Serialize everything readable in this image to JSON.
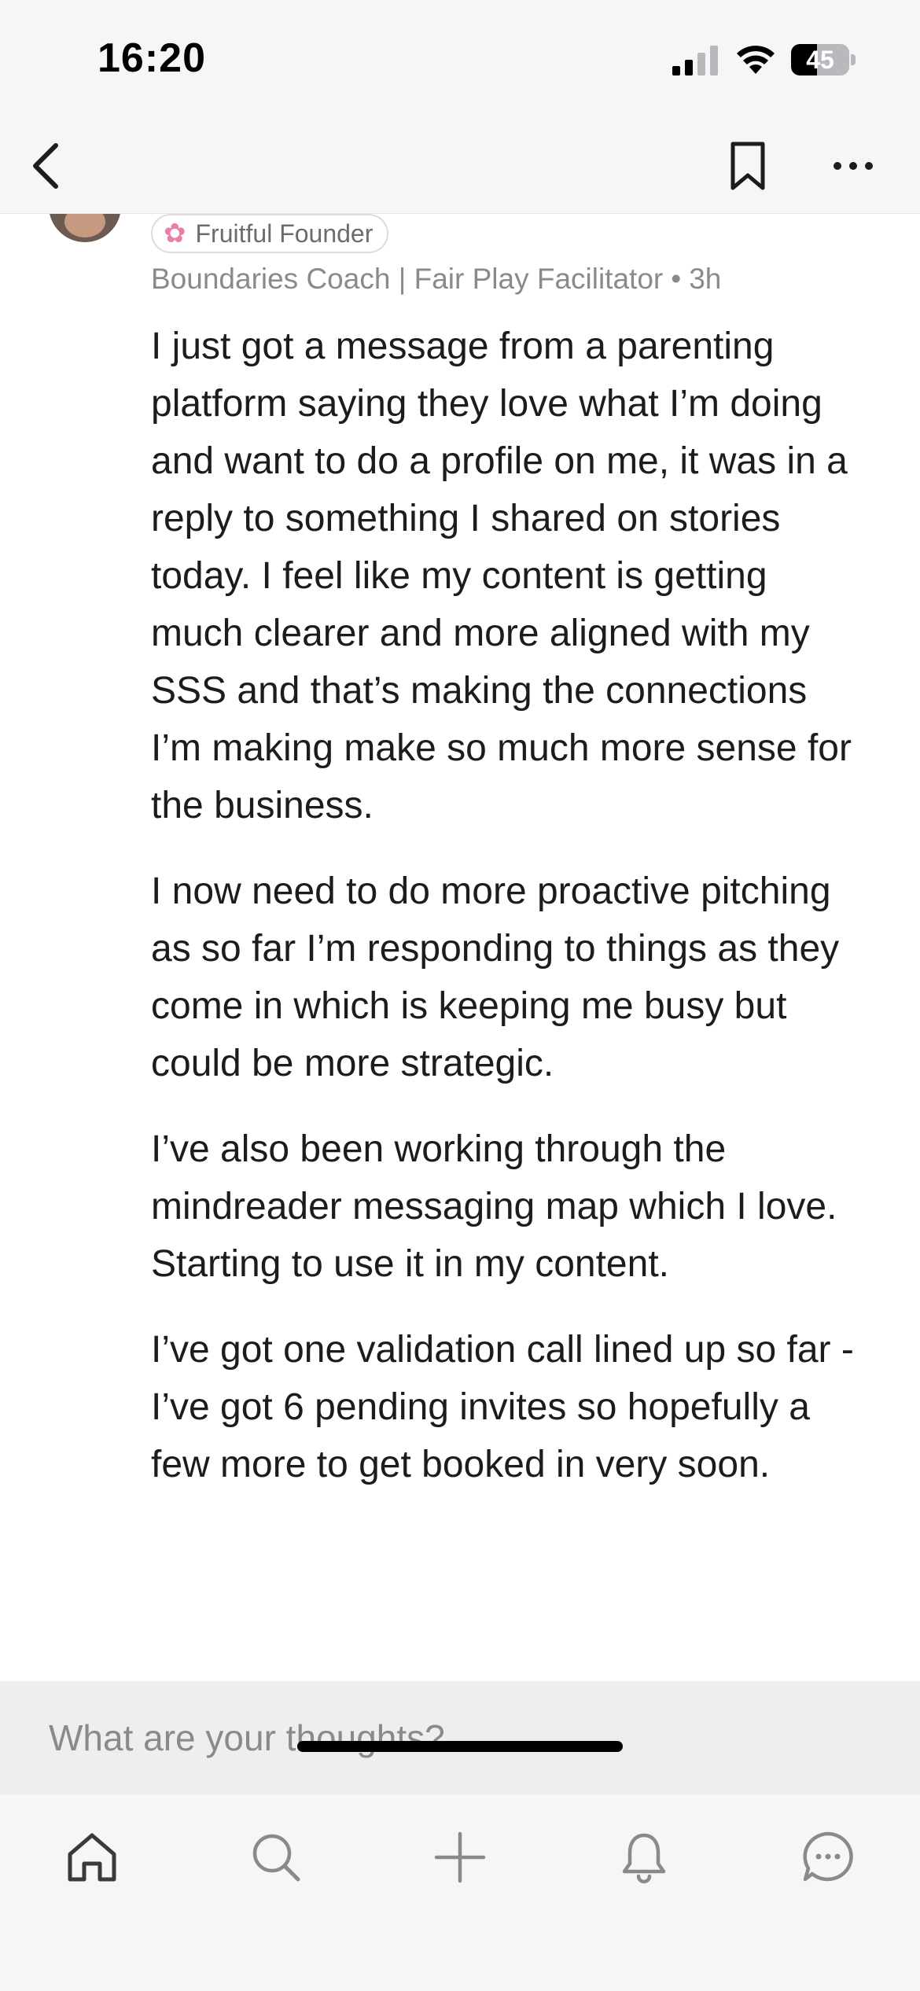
{
  "status_bar": {
    "time": "16:20",
    "battery_level": "45",
    "battery_fraction": 0.45
  },
  "nav": {
    "icons": [
      "chevron-left-icon",
      "bookmark-icon",
      "more-horizontal-icon"
    ]
  },
  "post": {
    "badge": {
      "icon": "cherry-blossom-icon",
      "label": "Fruitful Founder"
    },
    "author_title": "Boundaries Coach | Fair Play Facilitator",
    "separator": "•",
    "time_ago": "3h",
    "paragraphs": [
      "I just got a message from a parenting platform saying they love what I’m doing and want to do a profile on me, it was in a reply to something I shared on stories today. I feel like my content is getting much clearer and more aligned with my SSS and that’s making the connections I’m making make so much more sense for the business.",
      "I now need to do more proactive pitching as so far I’m responding to things as they come in which is keeping me busy but could be more strategic.",
      "I’ve also been working through the mindreader messaging map which I love. Starting to use it in my content.",
      "I’ve got one validation call lined up so far - I’ve got 6 pending invites so hopefully a few more to get booked in very soon."
    ]
  },
  "composer": {
    "placeholder": "What are your thoughts?",
    "value": ""
  },
  "tab_bar": {
    "tabs": [
      "home-icon",
      "search-icon",
      "plus-icon",
      "bell-icon",
      "chat-icon"
    ]
  },
  "colors": {
    "text": "#1c1c1e",
    "secondary": "#8a8a8e",
    "bar_background": "#f6f6f6",
    "composer_background": "#eeeeef",
    "badge_accent": "#e87fa8"
  }
}
